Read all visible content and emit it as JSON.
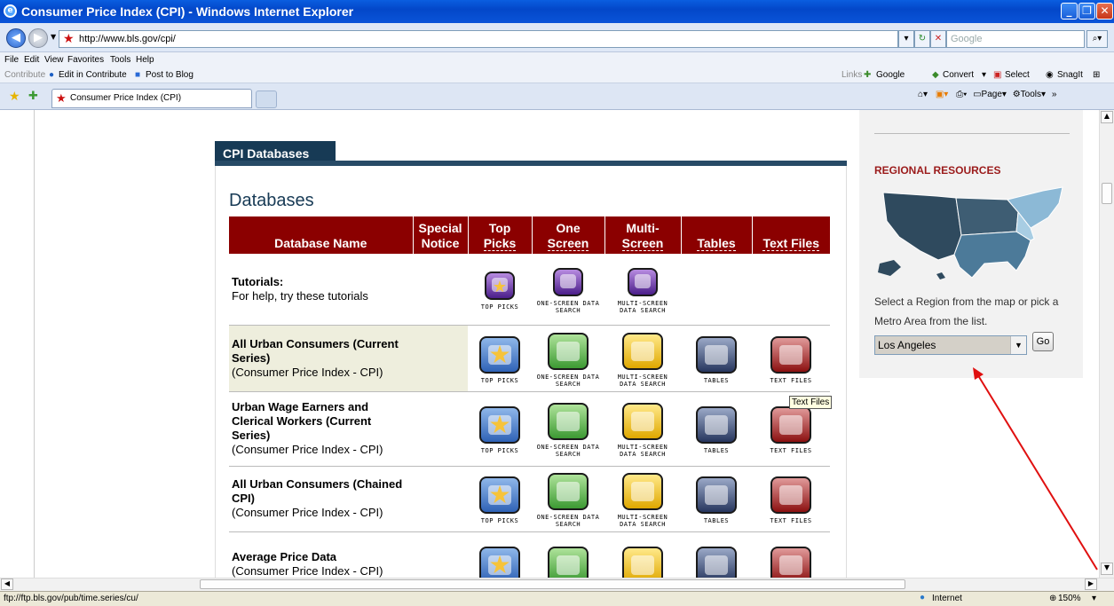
{
  "window": {
    "title": "Consumer Price Index (CPI) - Windows Internet Explorer"
  },
  "address": {
    "url": "http://www.bls.gov/cpi/",
    "search_placeholder": "Google"
  },
  "menu": [
    "File",
    "Edit",
    "View",
    "Favorites",
    "Tools",
    "Help"
  ],
  "contribute_bar": {
    "label": "Contribute",
    "edit": "Edit in Contribute",
    "post": "Post to Blog"
  },
  "links_bar": {
    "links": "Links",
    "google": "Google",
    "convert": "Convert",
    "select": "Select",
    "snagit": "SnagIt"
  },
  "tab": {
    "label": "Consumer Price Index (CPI)"
  },
  "command_bar": {
    "page": "Page",
    "tools": "Tools"
  },
  "panel": {
    "tab_title": "CPI Databases",
    "heading": "Databases"
  },
  "table": {
    "headers": {
      "name": "Database Name",
      "special_1": "Special",
      "special_2": "Notice",
      "top_1": "Top",
      "top_2": "Picks",
      "one_1": "One",
      "one_2": "Screen",
      "multi_1": "Multi-",
      "multi_2": "Screen",
      "tables": "Tables",
      "text": "Text Files"
    },
    "captions": {
      "top": "TOP PICKS",
      "one": "ONE-SCREEN DATA SEARCH",
      "multi": "MULTI-SCREEN DATA SEARCH",
      "tables": "TABLES",
      "text": "TEXT FILES"
    },
    "rows": [
      {
        "title": "Tutorials:",
        "subtitle": "For help, try these tutorials"
      },
      {
        "title": "All Urban Consumers (Current Series)",
        "subtitle": "(Consumer Price Index - CPI)"
      },
      {
        "title": "Urban Wage Earners and Clerical Workers (Current Series)",
        "subtitle": "(Consumer Price Index - CPI)"
      },
      {
        "title": "All Urban Consumers (Chained CPI)",
        "subtitle": "(Consumer Price Index - CPI)"
      },
      {
        "title": "Average Price Data",
        "subtitle": "(Consumer Price Index - CPI)"
      }
    ]
  },
  "tooltip": "Text Files",
  "regional": {
    "title": "REGIONAL RESOURCES",
    "text": "Select a Region from the map or pick a Metro Area from the list.",
    "selected": "Los Angeles",
    "go": "Go"
  },
  "status": {
    "url": "ftp://ftp.bls.gov/pub/time.series/cu/",
    "zone": "Internet",
    "zoom": "150%"
  },
  "colors": {
    "header_red": "#8b0000",
    "navy": "#173a55",
    "region_red": "#9b1b1b",
    "arrow": "#e01010"
  }
}
